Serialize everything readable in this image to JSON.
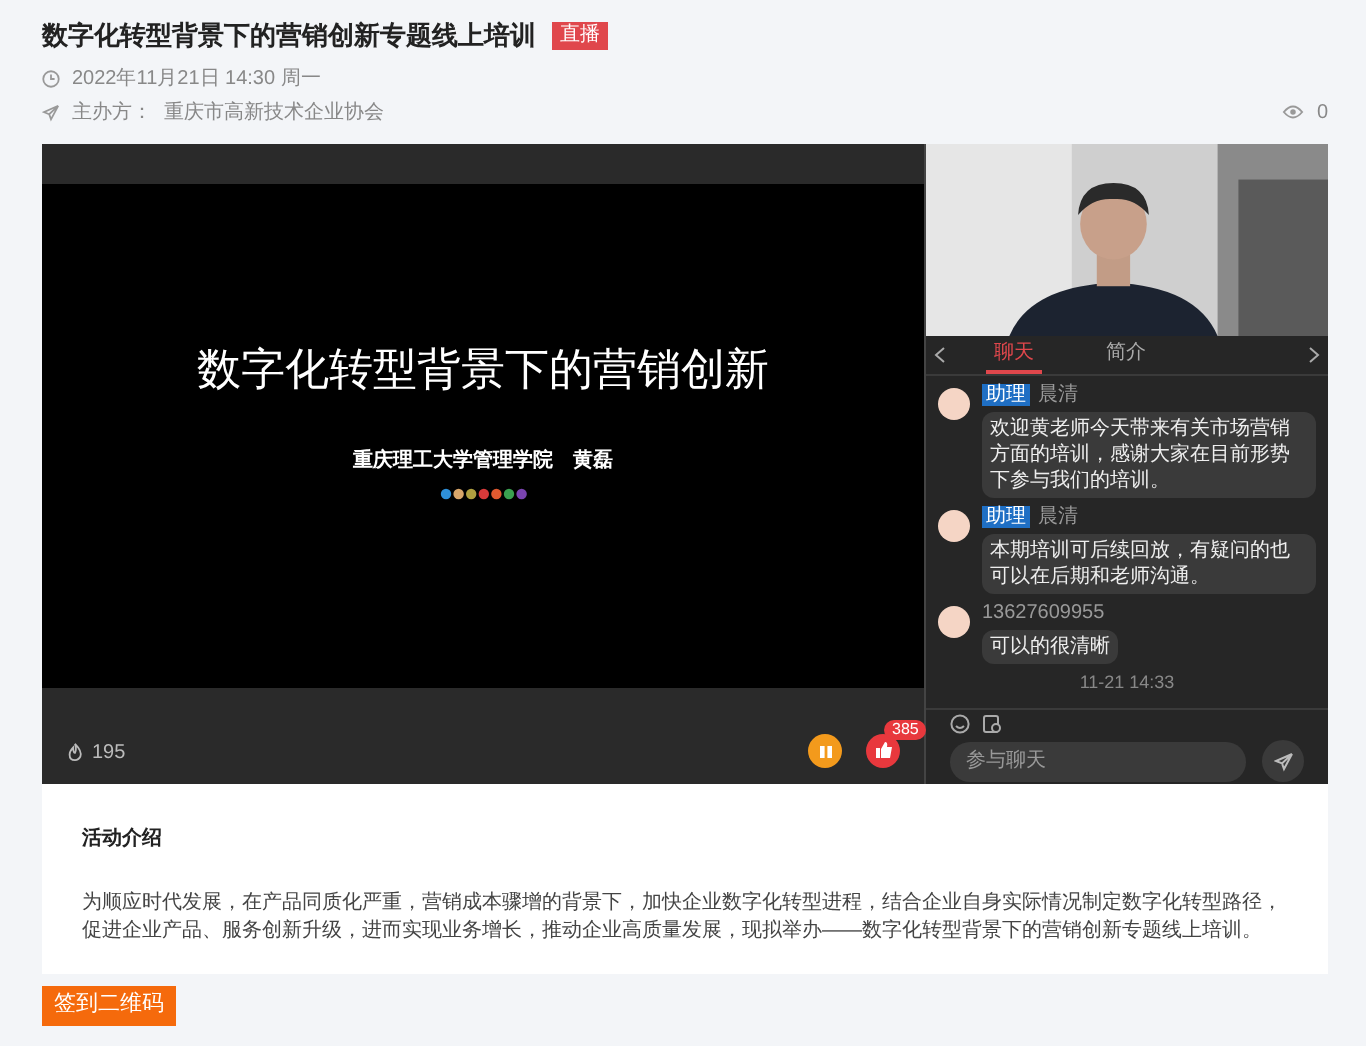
{
  "header": {
    "title": "数字化转型背景下的营销创新专题线上培训",
    "badge": "直播",
    "datetime": "2022年11月21日 14:30 周一",
    "organizer_label": "主办方：",
    "organizer": "重庆市高新技术企业协会",
    "views": "0"
  },
  "slide": {
    "title": "数字化转型背景下的营销创新",
    "subtitle": "重庆理工大学管理学院　黄磊"
  },
  "player_bar": {
    "popularity": "195",
    "likes": "385"
  },
  "chat": {
    "tabs": [
      {
        "label": "聊天",
        "selected": true
      },
      {
        "label": "简介",
        "selected": false
      }
    ],
    "messages": [
      {
        "role": "助理",
        "name": "晨清",
        "text": "欢迎黄老师今天带来有关市场营销方面的培训，感谢大家在目前形势下参与我们的培训。"
      },
      {
        "role": "助理",
        "name": "晨清",
        "text": "本期培训可后续回放，有疑问的也可以在后期和老师沟通。"
      },
      {
        "name": "13627609955",
        "text": "可以的很清晰"
      }
    ],
    "timestamp": "11-21 14:33",
    "input": {
      "placeholder": "参与聊天"
    }
  },
  "intro": {
    "heading": "活动介绍",
    "body": "为顺应时代发展，在产品同质化严重，营销成本骤增的背景下，加快企业数字化转型进程，结合企业自身实际情况制定数字化转型路径，促进企业产品、服务创新升级，进而实现业务增长，推动企业高质量发展，现拟举办——数字化转型背景下的营销创新专题线上培训。"
  },
  "qr_button": "签到二维码"
}
